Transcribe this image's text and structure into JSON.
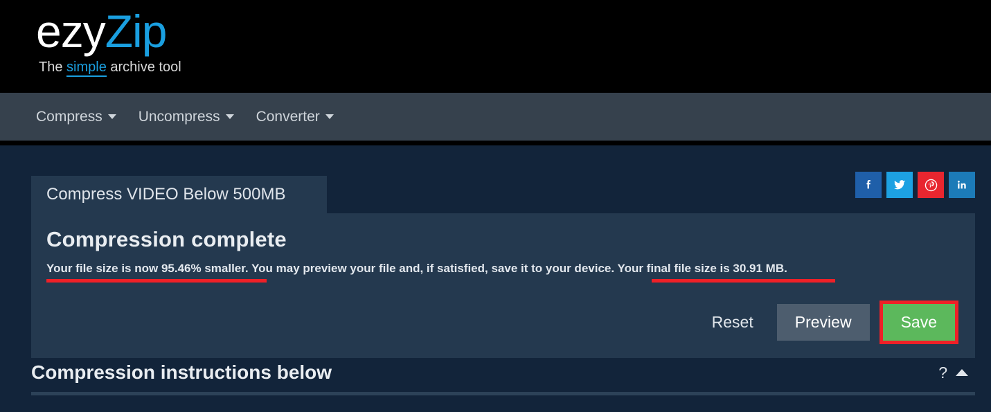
{
  "brand": {
    "name_part1": "ezy",
    "name_part2": "Zip",
    "tagline_pre": "The ",
    "tagline_link": "simple",
    "tagline_post": " archive tool"
  },
  "colors": {
    "accent_blue": "#1a9fe0",
    "page_bg": "#12243a",
    "card_bg": "#24394f",
    "navbar_bg": "#36414d",
    "save_green": "#5cb85c",
    "preview_gray": "#4d5d6e",
    "annotation_red": "#ef2027",
    "facebook": "#1f5fa9",
    "twitter": "#1da1e2",
    "pinterest": "#e8262f",
    "linkedin": "#1c7bb8"
  },
  "navbar": {
    "items": [
      {
        "label": "Compress"
      },
      {
        "label": "Uncompress"
      },
      {
        "label": "Converter"
      }
    ]
  },
  "card": {
    "tab_label": "Compress VIDEO Below 500MB",
    "result_title": "Compression complete",
    "result_message": "Your file size is now 95.46% smaller. You may preview your file and, if satisfied, save it to your device. Your final file size is 30.91 MB.",
    "percent_smaller": "95.46%",
    "final_file_size": "30.91 MB",
    "buttons": {
      "reset": "Reset",
      "preview": "Preview",
      "save": "Save"
    }
  },
  "social": {
    "items": [
      {
        "name": "facebook",
        "glyph": "f"
      },
      {
        "name": "twitter",
        "glyph": "t"
      },
      {
        "name": "pinterest",
        "glyph": "p"
      },
      {
        "name": "linkedin",
        "glyph": "in"
      }
    ]
  },
  "instructions": {
    "title": "Compression instructions below",
    "help_glyph": "?"
  }
}
